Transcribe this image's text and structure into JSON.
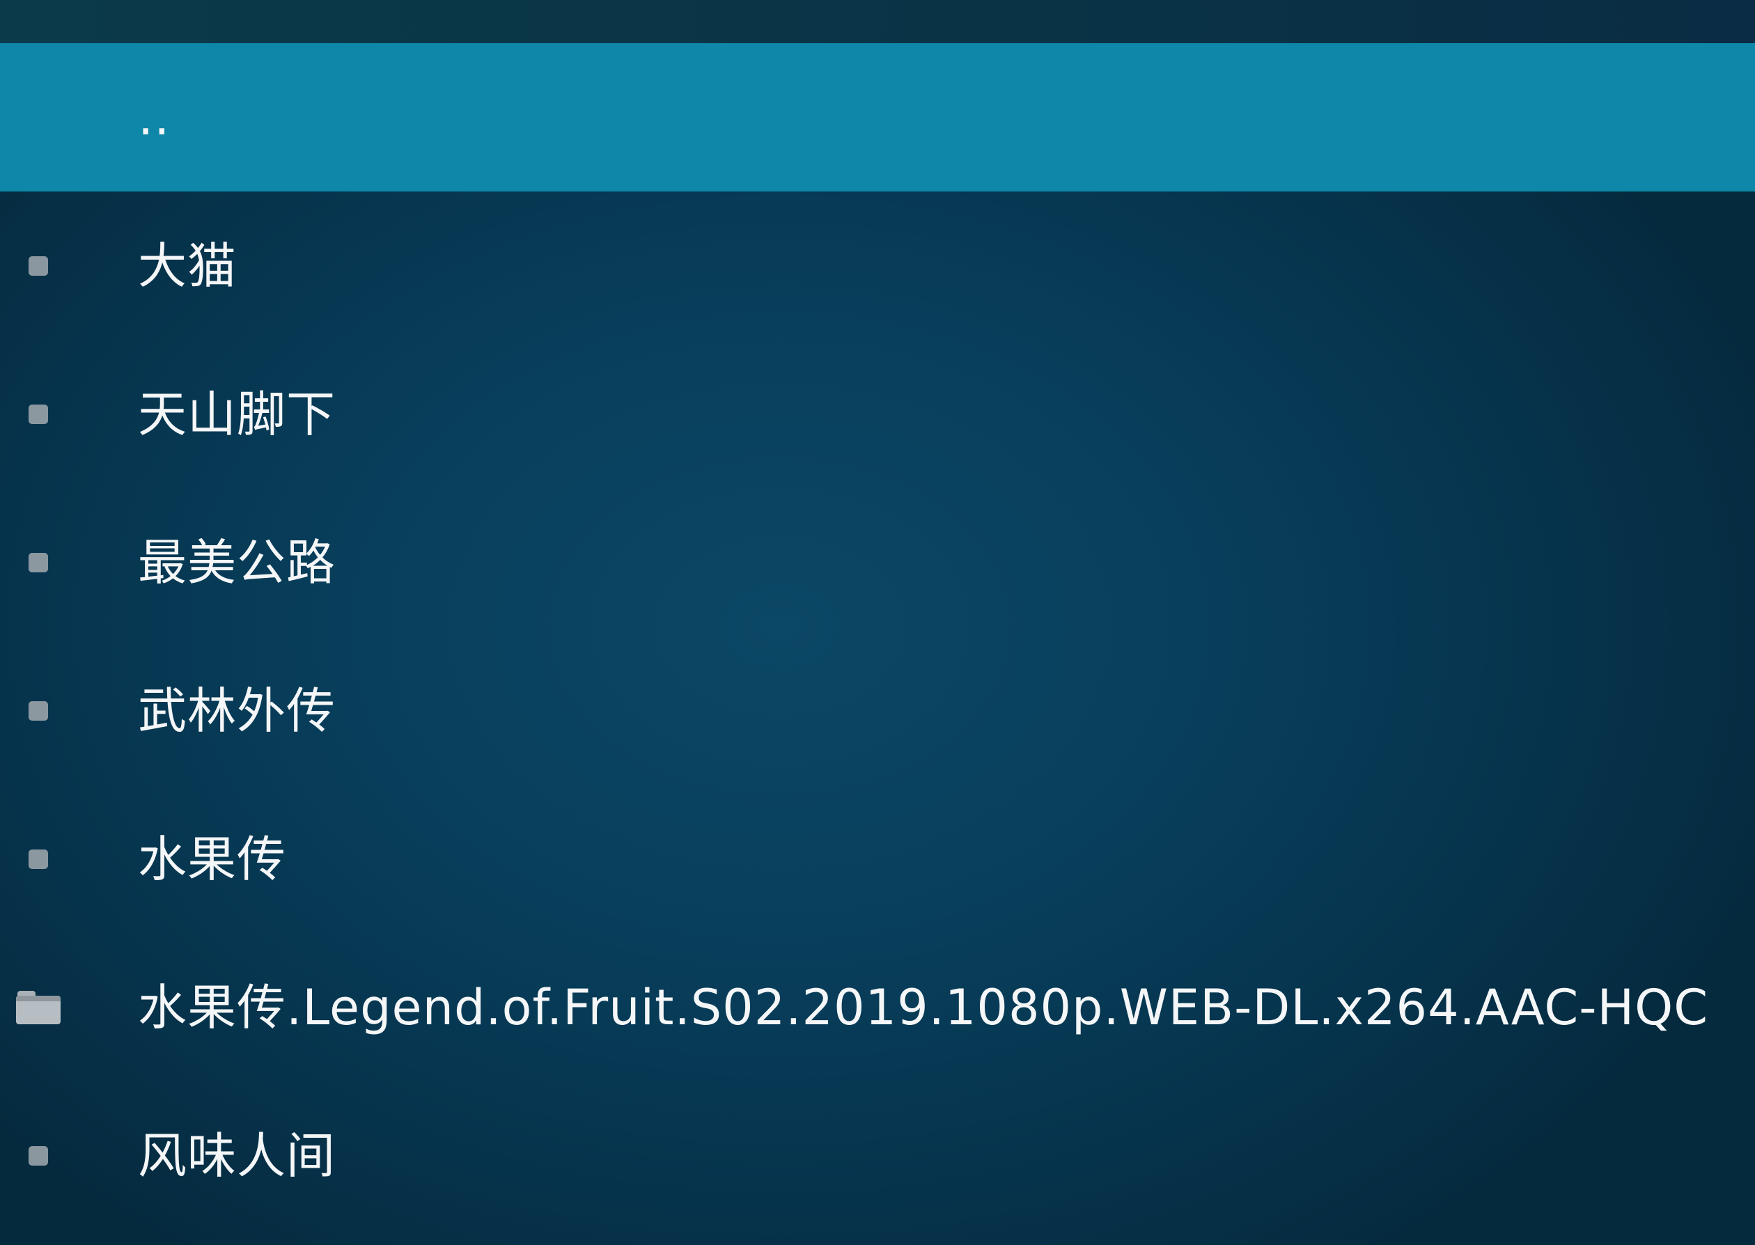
{
  "list": {
    "items": [
      {
        "label": "..",
        "icon": "none",
        "focused": true
      },
      {
        "label": "大猫",
        "icon": "bullet-icon",
        "focused": false
      },
      {
        "label": "天山脚下",
        "icon": "bullet-icon",
        "focused": false
      },
      {
        "label": "最美公路",
        "icon": "bullet-icon",
        "focused": false
      },
      {
        "label": "武林外传",
        "icon": "bullet-icon",
        "focused": false
      },
      {
        "label": "水果传",
        "icon": "bullet-icon",
        "focused": false
      },
      {
        "label": "水果传.Legend.of.Fruit.S02.2019.1080p.WEB-DL.x264.AAC-HQC",
        "icon": "folder-icon",
        "focused": false
      },
      {
        "label": "风味人间",
        "icon": "bullet-icon",
        "focused": false
      }
    ]
  },
  "colors": {
    "focus_highlight": "#0e87a9",
    "background": "#083f5c",
    "text": "#f4f6f7"
  }
}
